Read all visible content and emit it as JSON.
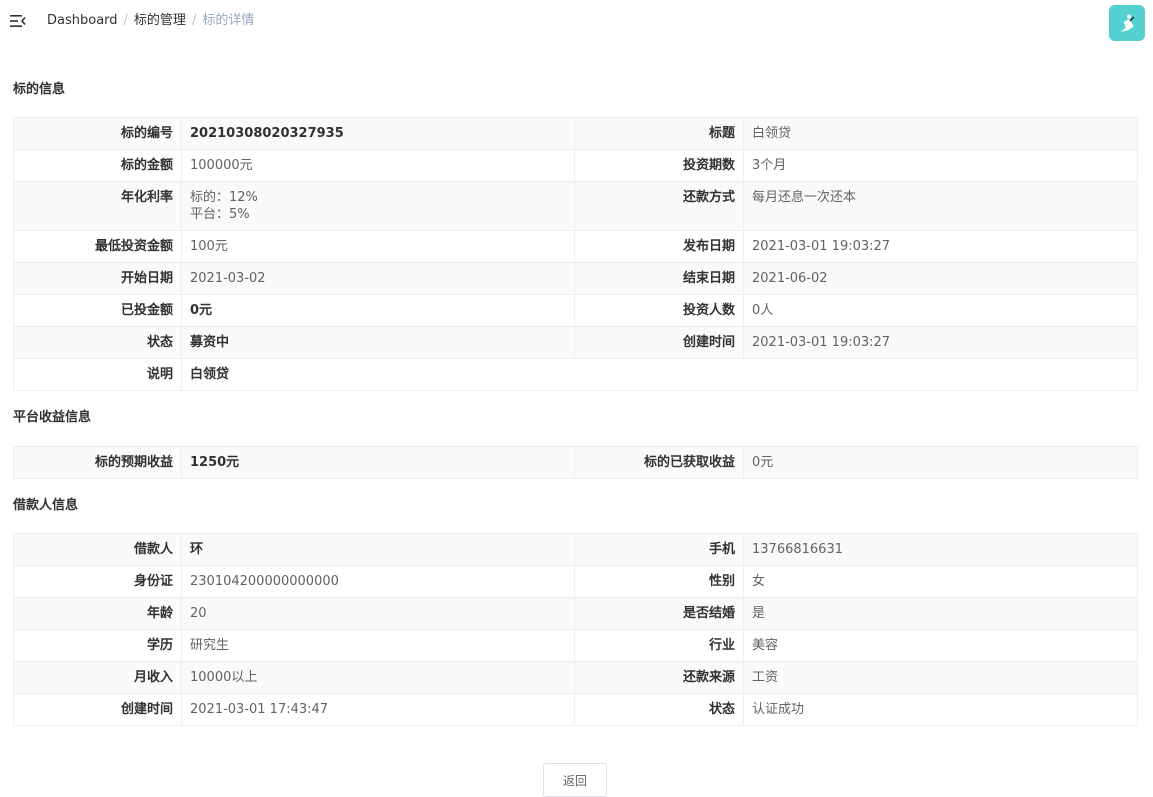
{
  "breadcrumb": [
    "Dashboard",
    "标的管理",
    "标的详情"
  ],
  "sections": {
    "loan": "标的信息",
    "platform": "平台收益信息",
    "borrower": "借款人信息"
  },
  "loan": {
    "number_label": "标的编号",
    "number": "20210308020327935",
    "title_label": "标题",
    "title": "白领贷",
    "amount_label": "标的金额",
    "amount": "100000元",
    "periods_label": "投资期数",
    "periods": "3个月",
    "rate_label": "年化利率",
    "rate_loan": "标的：12%",
    "rate_platform": "平台：5%",
    "repay_label": "还款方式",
    "repay": "每月还息一次还本",
    "min_label": "最低投资金额",
    "min": "100元",
    "publish_label": "发布日期",
    "publish": "2021-03-01 19:03:27",
    "start_label": "开始日期",
    "start": "2021-03-02",
    "end_label": "结束日期",
    "end": "2021-06-02",
    "invested_label": "已投金额",
    "invested": "0元",
    "investors_label": "投资人数",
    "investors": "0人",
    "status_label": "状态",
    "status": "募资中",
    "created_label": "创建时间",
    "created": "2021-03-01 19:03:27",
    "desc_label": "说明",
    "desc": "白领贷"
  },
  "platform": {
    "expected_label": "标的预期收益",
    "expected": "1250元",
    "earned_label": "标的已获取收益",
    "earned": "0元"
  },
  "borrower": {
    "name_label": "借款人",
    "name": "环",
    "phone_label": "手机",
    "phone": "13766816631",
    "id_label": "身份证",
    "id": "230104200000000000",
    "gender_label": "性别",
    "gender": "女",
    "age_label": "年龄",
    "age": "20",
    "married_label": "是否结婚",
    "married": "是",
    "edu_label": "学历",
    "edu": "研究生",
    "industry_label": "行业",
    "industry": "美容",
    "income_label": "月收入",
    "income": "10000以上",
    "source_label": "还款来源",
    "source": "工资",
    "created_label": "创建时间",
    "created": "2021-03-01 17:43:47",
    "status_label": "状态",
    "status": "认证成功"
  },
  "actions": {
    "back": "返回"
  },
  "colors": {
    "avatar_bg": "#53d1d1",
    "border": "#ebeef5",
    "stripe": "#fafafa",
    "crumb_current": "#97a8be"
  },
  "icons": {
    "menu": "hamburger-fold-icon",
    "avatar": "user-avatar-icon"
  }
}
